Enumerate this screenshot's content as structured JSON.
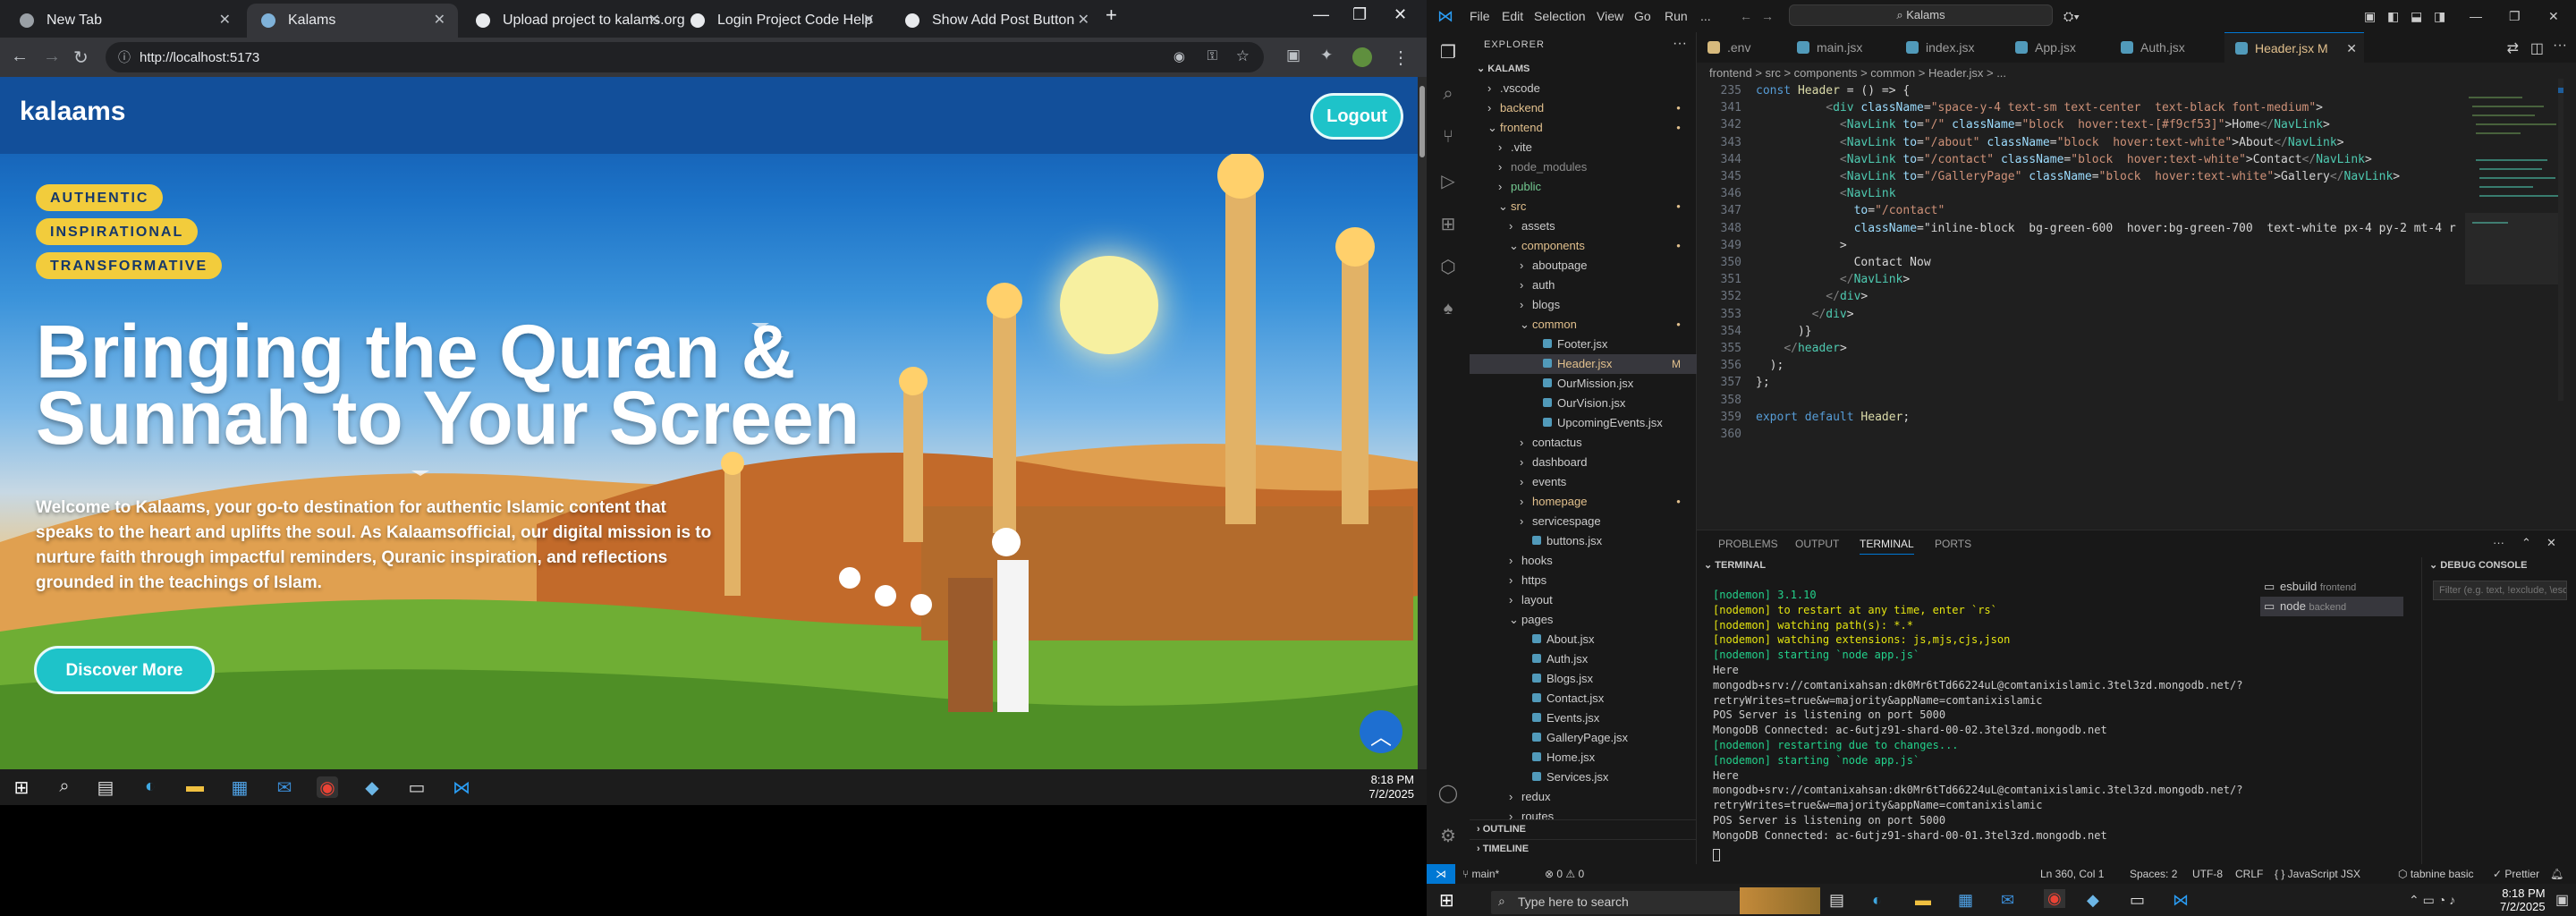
{
  "browser": {
    "tabs": [
      {
        "label": "New Tab",
        "active": false
      },
      {
        "label": "Kalams",
        "active": true
      },
      {
        "label": "Upload project to kalams.org",
        "active": false
      },
      {
        "label": "Login Project Code Help",
        "active": false
      },
      {
        "label": "Show Add Post Button",
        "active": false
      }
    ],
    "url": "http://localhost:5173"
  },
  "site": {
    "logo": "kalaams",
    "logout": "Logout",
    "badges": [
      "AUTHENTIC",
      "INSPIRATIONAL",
      "TRANSFORMATIVE"
    ],
    "hero_line1": "Bringing the Quran &",
    "hero_line2": "Sunnah to Your Screen",
    "subtitle": "Welcome to Kalaams, your go-to destination for authentic Islamic content that speaks to the heart and uplifts the soul. As Kalaamsofficial, our digital mission is to nurture faith through impactful reminders, Quranic inspiration, and reflections grounded in the teachings of Islam.",
    "cta": "Discover More",
    "to_top": "^"
  },
  "taskbar_left": {
    "time": "8:18 PM",
    "date": "7/2/2025"
  },
  "vscode": {
    "menu": [
      "File",
      "Edit",
      "Selection",
      "View",
      "Go",
      "Run",
      "..."
    ],
    "search": "Kalams",
    "explorer_title": "EXPLORER",
    "root": "KALAMS",
    "tree": [
      {
        "label": ".vscode",
        "depth": 1,
        "type": "folder",
        "open": false
      },
      {
        "label": "backend",
        "depth": 1,
        "type": "folder",
        "open": false,
        "git": true
      },
      {
        "label": "frontend",
        "depth": 1,
        "type": "folder",
        "open": true,
        "git": true
      },
      {
        "label": ".vite",
        "depth": 2,
        "type": "folder",
        "open": false
      },
      {
        "label": "node_modules",
        "depth": 2,
        "type": "folder",
        "open": false,
        "dim": true
      },
      {
        "label": "public",
        "depth": 2,
        "type": "folder",
        "open": false,
        "green": true
      },
      {
        "label": "src",
        "depth": 2,
        "type": "folder",
        "open": true,
        "git": true
      },
      {
        "label": "assets",
        "depth": 3,
        "type": "folder",
        "open": false
      },
      {
        "label": "components",
        "depth": 3,
        "type": "folder",
        "open": true,
        "git": true
      },
      {
        "label": "aboutpage",
        "depth": 4,
        "type": "folder",
        "open": false
      },
      {
        "label": "auth",
        "depth": 4,
        "type": "folder",
        "open": false
      },
      {
        "label": "blogs",
        "depth": 4,
        "type": "folder",
        "open": false
      },
      {
        "label": "common",
        "depth": 4,
        "type": "folder",
        "open": true,
        "git": true
      },
      {
        "label": "Footer.jsx",
        "depth": 5,
        "type": "file"
      },
      {
        "label": "Header.jsx",
        "depth": 5,
        "type": "file",
        "selected": true,
        "mod": "M",
        "git": true
      },
      {
        "label": "OurMission.jsx",
        "depth": 5,
        "type": "file"
      },
      {
        "label": "OurVision.jsx",
        "depth": 5,
        "type": "file"
      },
      {
        "label": "UpcomingEvents.jsx",
        "depth": 5,
        "type": "file"
      },
      {
        "label": "contactus",
        "depth": 4,
        "type": "folder",
        "open": false
      },
      {
        "label": "dashboard",
        "depth": 4,
        "type": "folder",
        "open": false
      },
      {
        "label": "events",
        "depth": 4,
        "type": "folder",
        "open": false
      },
      {
        "label": "homepage",
        "depth": 4,
        "type": "folder",
        "open": false,
        "git": true
      },
      {
        "label": "servicespage",
        "depth": 4,
        "type": "folder",
        "open": false
      },
      {
        "label": "buttons.jsx",
        "depth": 4,
        "type": "file"
      },
      {
        "label": "hooks",
        "depth": 3,
        "type": "folder",
        "open": false
      },
      {
        "label": "https",
        "depth": 3,
        "type": "folder",
        "open": false
      },
      {
        "label": "layout",
        "depth": 3,
        "type": "folder",
        "open": false
      },
      {
        "label": "pages",
        "depth": 3,
        "type": "folder",
        "open": true
      },
      {
        "label": "About.jsx",
        "depth": 4,
        "type": "file"
      },
      {
        "label": "Auth.jsx",
        "depth": 4,
        "type": "file"
      },
      {
        "label": "Blogs.jsx",
        "depth": 4,
        "type": "file"
      },
      {
        "label": "Contact.jsx",
        "depth": 4,
        "type": "file"
      },
      {
        "label": "Events.jsx",
        "depth": 4,
        "type": "file"
      },
      {
        "label": "GalleryPage.jsx",
        "depth": 4,
        "type": "file"
      },
      {
        "label": "Home.jsx",
        "depth": 4,
        "type": "file"
      },
      {
        "label": "Services.jsx",
        "depth": 4,
        "type": "file"
      },
      {
        "label": "redux",
        "depth": 3,
        "type": "folder",
        "open": false
      },
      {
        "label": "routes",
        "depth": 3,
        "type": "folder",
        "open": false
      }
    ],
    "outline": "OUTLINE",
    "timeline": "TIMELINE",
    "editor_tabs": [
      {
        "label": ".env",
        "color": "#d7ba7d",
        "active": false
      },
      {
        "label": "main.jsx",
        "color": "#519aba",
        "active": false
      },
      {
        "label": "index.jsx",
        "color": "#519aba",
        "active": false
      },
      {
        "label": "App.jsx",
        "color": "#519aba",
        "active": false
      },
      {
        "label": "Auth.jsx",
        "color": "#519aba",
        "active": false
      },
      {
        "label": "Header.jsx  M",
        "color": "#519aba",
        "active": true
      }
    ],
    "breadcrumb": "frontend > src > components > common > Header.jsx > ...",
    "code_lines": [
      {
        "n": "235",
        "t": "const Header = () => {"
      },
      {
        "n": "341",
        "t": "          <div className=\"space-y-4 text-sm text-center  text-black font-medium\">"
      },
      {
        "n": "342",
        "t": "            <NavLink to=\"/\" className=\"block  hover:text-[#f9cf53]\">Home</NavLink>"
      },
      {
        "n": "343",
        "t": "            <NavLink to=\"/about\" className=\"block  hover:text-white\">About</NavLink>"
      },
      {
        "n": "344",
        "t": "            <NavLink to=\"/contact\" className=\"block  hover:text-white\">Contact</NavLink>"
      },
      {
        "n": "345",
        "t": "            <NavLink to=\"/GalleryPage\" className=\"block  hover:text-white\">Gallery</NavLink>"
      },
      {
        "n": "346",
        "t": "            <NavLink"
      },
      {
        "n": "347",
        "t": "              to=\"/contact\""
      },
      {
        "n": "348",
        "t": "              className=\"inline-block  bg-green-600  hover:bg-green-700  text-white px-4 py-2 mt-4 r"
      },
      {
        "n": "349",
        "t": "            >"
      },
      {
        "n": "350",
        "t": "              Contact Now"
      },
      {
        "n": "351",
        "t": "            </NavLink>"
      },
      {
        "n": "352",
        "t": "          </div>"
      },
      {
        "n": "353",
        "t": "        </div>"
      },
      {
        "n": "354",
        "t": "      )}"
      },
      {
        "n": "355",
        "t": "    </header>"
      },
      {
        "n": "356",
        "t": "  );"
      },
      {
        "n": "357",
        "t": "};"
      },
      {
        "n": "358",
        "t": ""
      },
      {
        "n": "359",
        "t": "export default Header;"
      },
      {
        "n": "360",
        "t": ""
      }
    ],
    "panel_tabs": [
      "PROBLEMS",
      "OUTPUT",
      "TERMINAL",
      "PORTS"
    ],
    "terminal_title": "TERMINAL",
    "terminal_lines": [
      "[nodemon] 3.1.10",
      "[nodemon] to restart at any time, enter `rs`",
      "[nodemon] watching path(s): *.*",
      "[nodemon] watching extensions: js,mjs,cjs,json",
      "[nodemon] starting `node app.js`",
      "Here",
      "mongodb+srv://comtanixahsan:dk0Mr6tTd66224uL@comtanixislamic.3tel3zd.mongodb.net/?",
      "retryWrites=true&w=majority&appName=comtanixislamic",
      "POS Server is listening on port 5000",
      "MongoDB Connected: ac-6utjz91-shard-00-02.3tel3zd.mongodb.net",
      "[nodemon] restarting due to changes...",
      "[nodemon] starting `node app.js`",
      "Here",
      "mongodb+srv://comtanixahsan:dk0Mr6tTd66224uL@comtanixislamic.3tel3zd.mongodb.net/?",
      "retryWrites=true&w=majority&appName=comtanixislamic",
      "POS Server is listening on port 5000",
      "MongoDB Connected: ac-6utjz91-shard-00-01.3tel3zd.mongodb.net"
    ],
    "terminals": [
      {
        "name": "esbuild",
        "cwd": "frontend"
      },
      {
        "name": "node",
        "cwd": "backend"
      }
    ],
    "debug_console": "DEBUG CONSOLE",
    "debug_filter_placeholder": "Filter (e.g. text, !exclude, \\escape)",
    "status": {
      "branch": "main*",
      "errors": "⊗ 0 ⚠ 0",
      "position": "Ln 360, Col 1",
      "spaces": "Spaces: 2",
      "encoding": "UTF-8",
      "eol": "CRLF",
      "language": "{ } JavaScript JSX",
      "tabnine": "tabnine basic",
      "prettier": "✓ Prettier"
    },
    "taskbar": {
      "search_placeholder": "Type here to search",
      "time": "8:18 PM",
      "date": "7/2/2025"
    }
  },
  "colors": {
    "accent": "#1ec3c9",
    "badge": "#f2cc3c",
    "vscode_blue": "#0078d4"
  }
}
